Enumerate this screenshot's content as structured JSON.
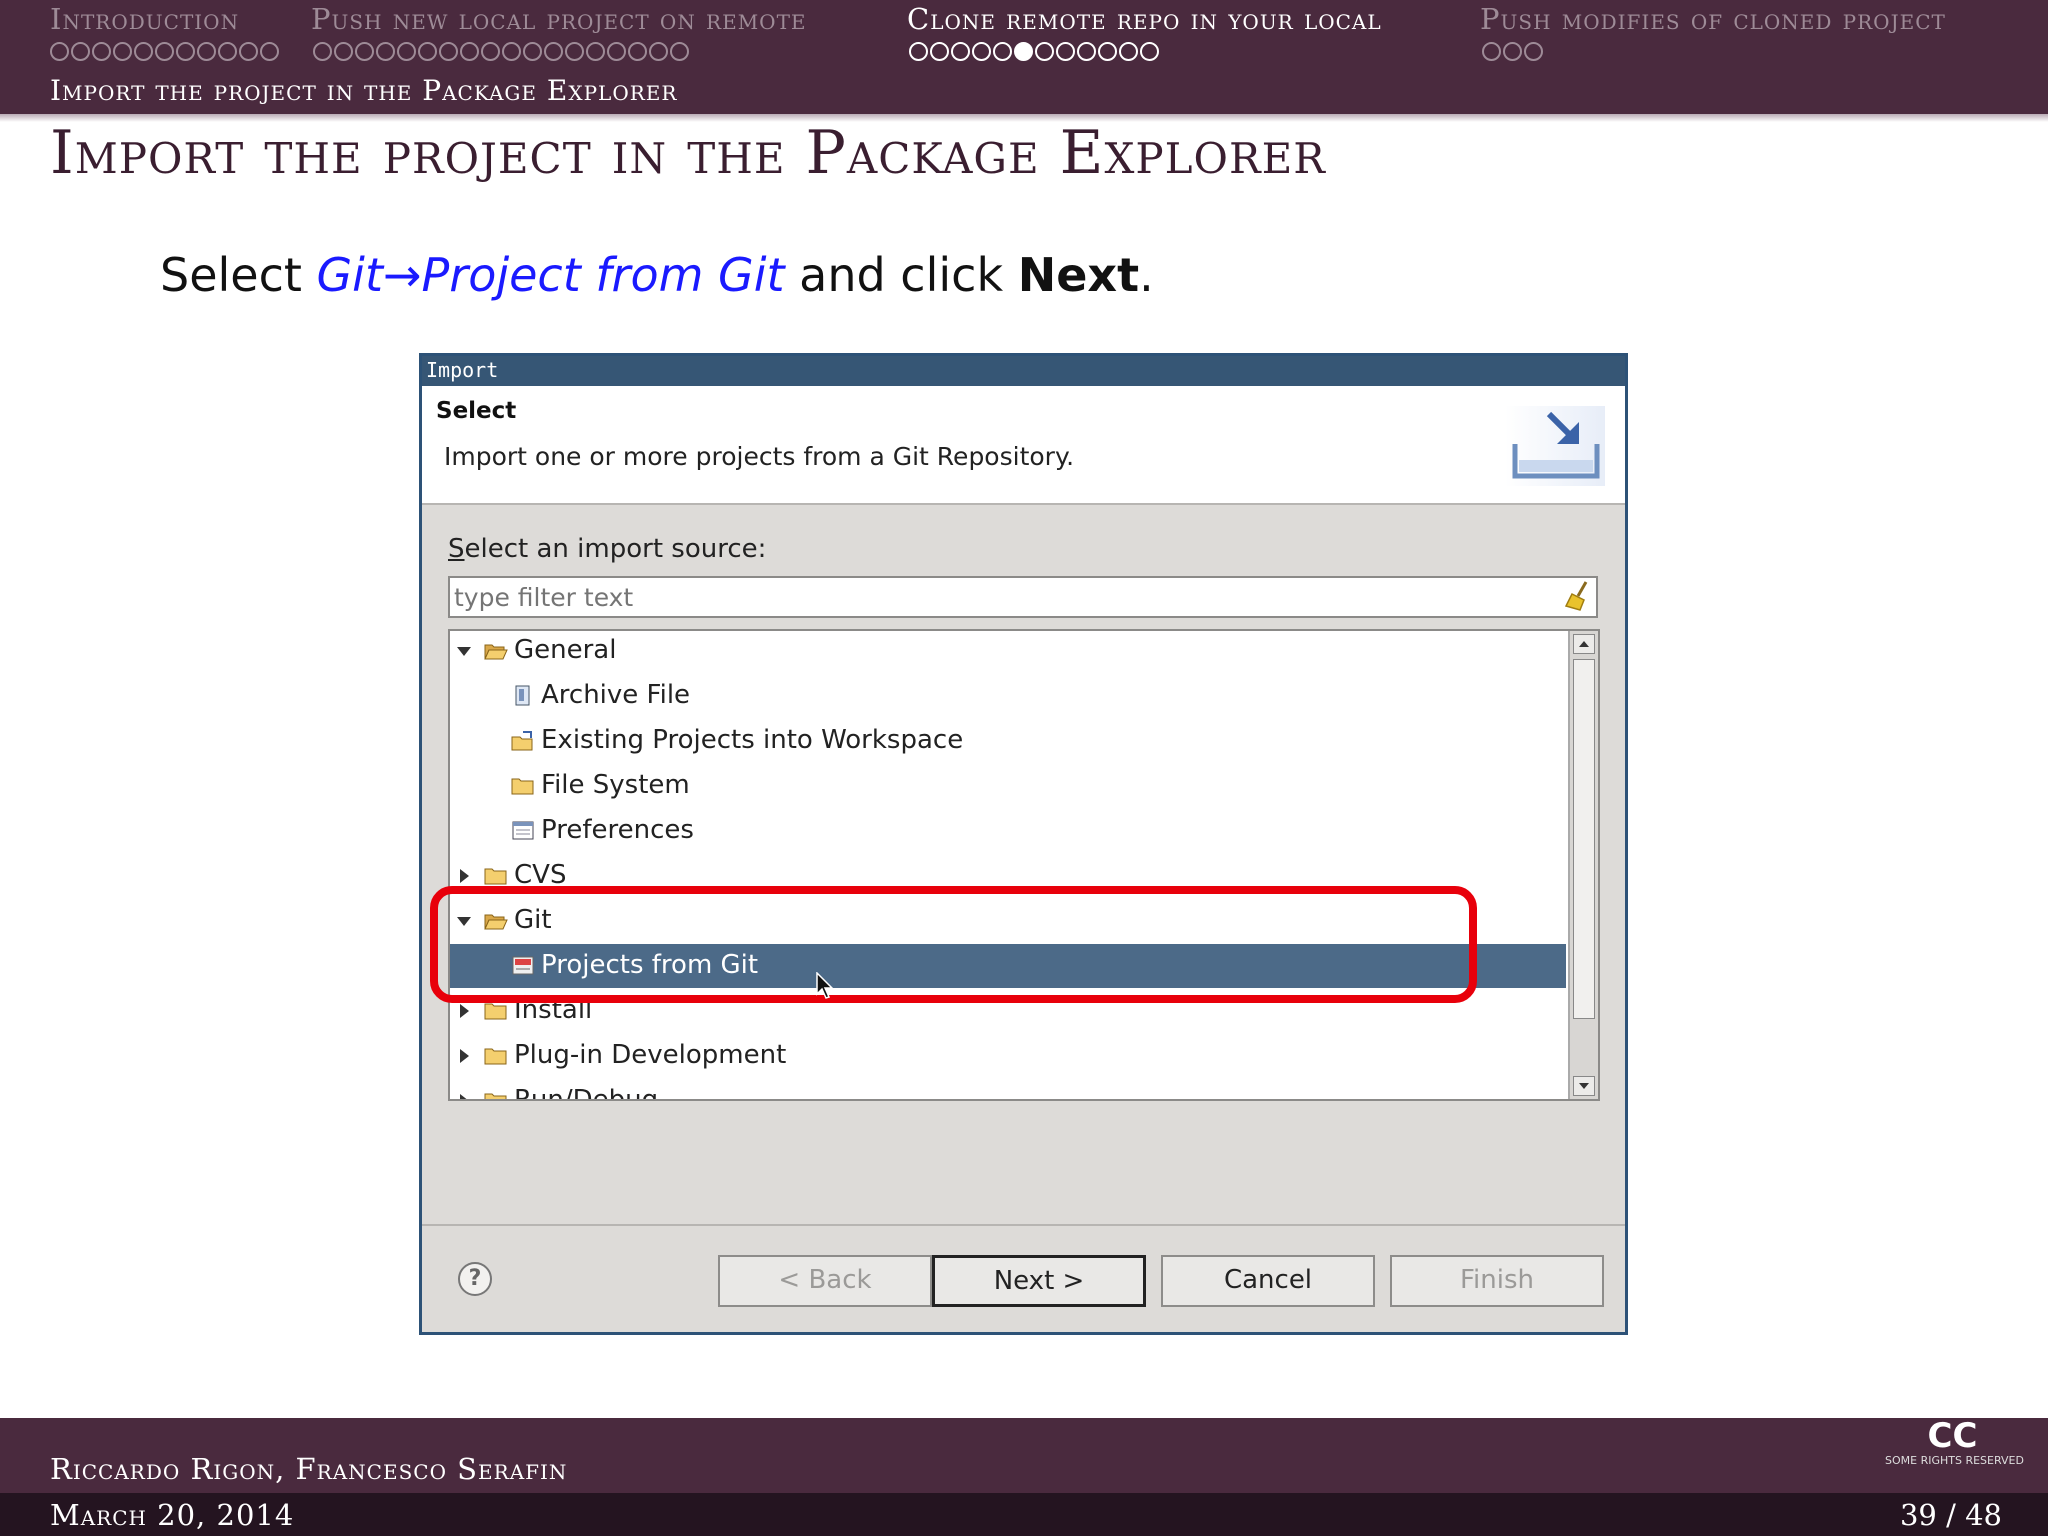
{
  "header": {
    "sections": [
      {
        "label": "Introduction",
        "dots": 11,
        "filled_index": -1,
        "active": false
      },
      {
        "label": "Push new local project on remote",
        "dots": 18,
        "filled_index": -1,
        "active": false
      },
      {
        "label": "Clone remote repo in your local",
        "dots": 12,
        "filled_index": 5,
        "active": true
      },
      {
        "label": "Push modifies of cloned project",
        "dots": 3,
        "filled_index": -1,
        "active": false
      }
    ],
    "subsection": "Import the project in the Package Explorer",
    "colors": {
      "background": "#4a2a3e",
      "inactive_text": "#9e8b97",
      "active_text": "#ffffff"
    }
  },
  "frame": {
    "title": "Import the project in the Package Explorer",
    "instruction": {
      "prefix": "Select ",
      "menu_path": "Git→Project from Git",
      "middle": " and click ",
      "action": "Next",
      "suffix": "."
    }
  },
  "dialog": {
    "window_title": "Import",
    "heading": "Select",
    "description": "Import one or more projects from a Git Repository.",
    "source_label_accel": "S",
    "source_label_rest": "elect an import source:",
    "filter_placeholder": "type filter text",
    "tree": [
      {
        "label": "General",
        "level": 0,
        "expanded": true,
        "icon": "folder-open-icon"
      },
      {
        "label": "Archive File",
        "level": 1,
        "icon": "archive-file-icon"
      },
      {
        "label": "Existing Projects into Workspace",
        "level": 1,
        "icon": "projects-workspace-icon"
      },
      {
        "label": "File System",
        "level": 1,
        "icon": "folder-icon"
      },
      {
        "label": "Preferences",
        "level": 1,
        "icon": "preferences-icon"
      },
      {
        "label": "CVS",
        "level": 0,
        "expanded": false,
        "icon": "folder-icon"
      },
      {
        "label": "Git",
        "level": 0,
        "expanded": true,
        "icon": "folder-open-icon"
      },
      {
        "label": "Projects from Git",
        "level": 1,
        "icon": "git-repo-icon",
        "selected": true
      },
      {
        "label": "Install",
        "level": 0,
        "expanded": false,
        "icon": "folder-icon"
      },
      {
        "label": "Plug-in Development",
        "level": 0,
        "expanded": false,
        "icon": "folder-icon"
      },
      {
        "label": "Run/Debug",
        "level": 0,
        "expanded": false,
        "icon": "folder-icon"
      }
    ],
    "buttons": {
      "back": "< Back",
      "next": "Next >",
      "cancel": "Cancel",
      "finish": "Finish"
    },
    "colors": {
      "selection": "#4c6a88",
      "titlebar": "#365675",
      "highlight": "#e8000b"
    }
  },
  "footer": {
    "authors": "Riccardo Rigon, Francesco Serafin",
    "date": "March 20, 2014",
    "page": "39 / 48",
    "license_mark": "CC",
    "license_text": "SOME RIGHTS RESERVED"
  }
}
